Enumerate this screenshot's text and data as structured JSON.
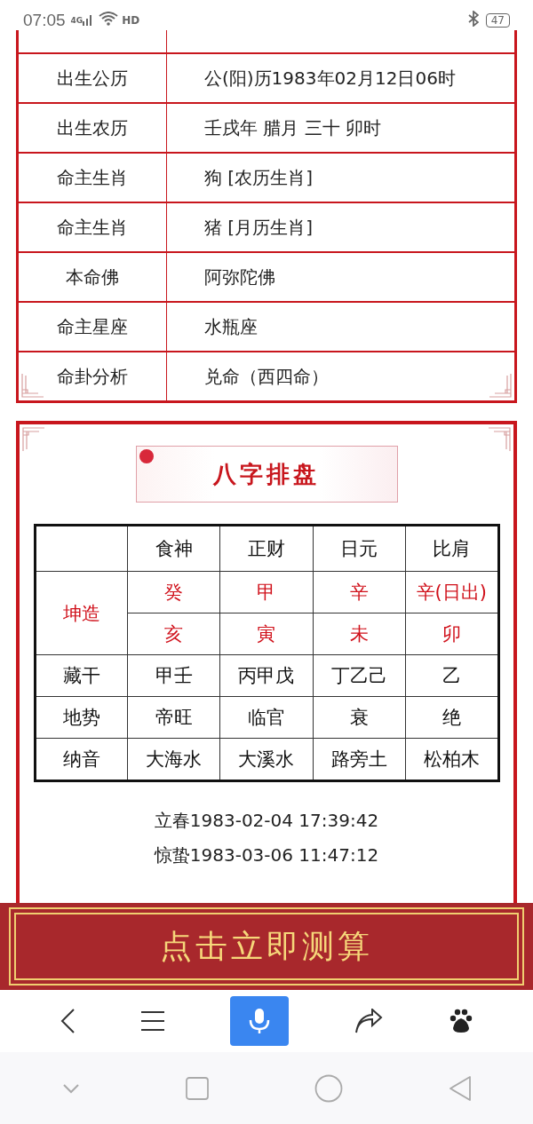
{
  "status_bar": {
    "time": "07:05",
    "network": "4G",
    "hd": "HD",
    "battery": "47"
  },
  "info_table": {
    "rows": [
      {
        "label": "出生公历",
        "value": "公(阳)历1983年02月12日06时"
      },
      {
        "label": "出生农历",
        "value": "壬戌年 腊月 三十 卯时"
      },
      {
        "label": "命主生肖",
        "value": "狗 [农历生肖]"
      },
      {
        "label": "命主生肖",
        "value": "猪 [月历生肖]"
      },
      {
        "label": "本命佛",
        "value": "阿弥陀佛"
      },
      {
        "label": "命主星座",
        "value": "水瓶座"
      },
      {
        "label": "命卦分析",
        "value": "兑命（西四命）"
      }
    ]
  },
  "bazi": {
    "title": "八字排盘",
    "header": [
      "食神",
      "正财",
      "日元",
      "比肩"
    ],
    "pillar_label": "坤造",
    "stems": [
      "癸",
      "甲",
      "辛",
      "辛(日出)"
    ],
    "branches": [
      "亥",
      "寅",
      "未",
      "卯"
    ],
    "rows": [
      {
        "label": "藏干",
        "cells": [
          "甲壬",
          "丙甲戊",
          "丁乙己",
          "乙"
        ]
      },
      {
        "label": "地势",
        "cells": [
          "帝旺",
          "临官",
          "衰",
          "绝"
        ]
      },
      {
        "label": "纳音",
        "cells": [
          "大海水",
          "大溪水",
          "路旁土",
          "松柏木"
        ]
      }
    ],
    "solar_terms": [
      "立春1983-02-04 17:39:42",
      "惊蛰1983-03-06 11:47:12"
    ]
  },
  "banner": {
    "label": "点击立即测算"
  }
}
